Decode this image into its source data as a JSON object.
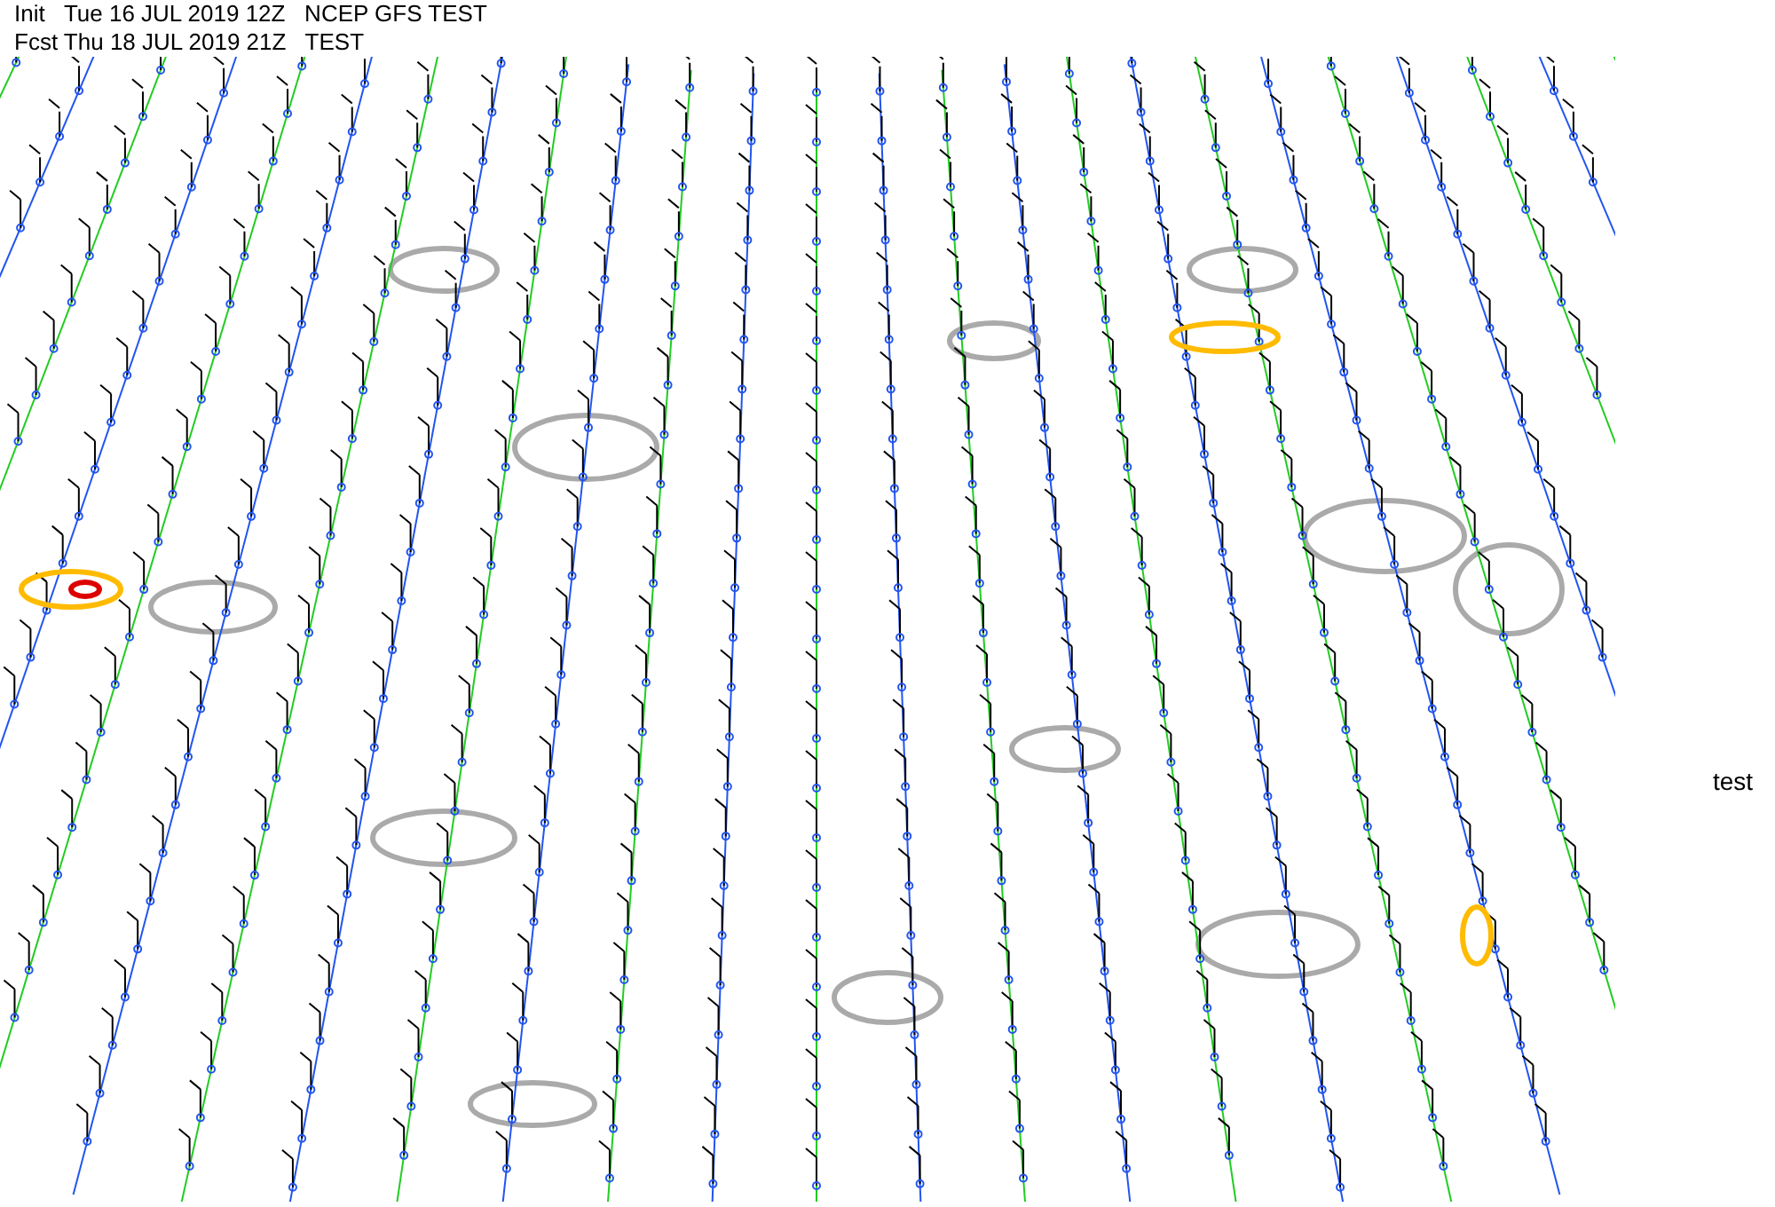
{
  "header": {
    "lines": [
      "Init   Tue 16 JUL 2019 12Z   NCEP GFS TEST",
      "Fcst Thu 18 JUL 2019 21Z   TEST"
    ]
  },
  "side_label": "test"
}
